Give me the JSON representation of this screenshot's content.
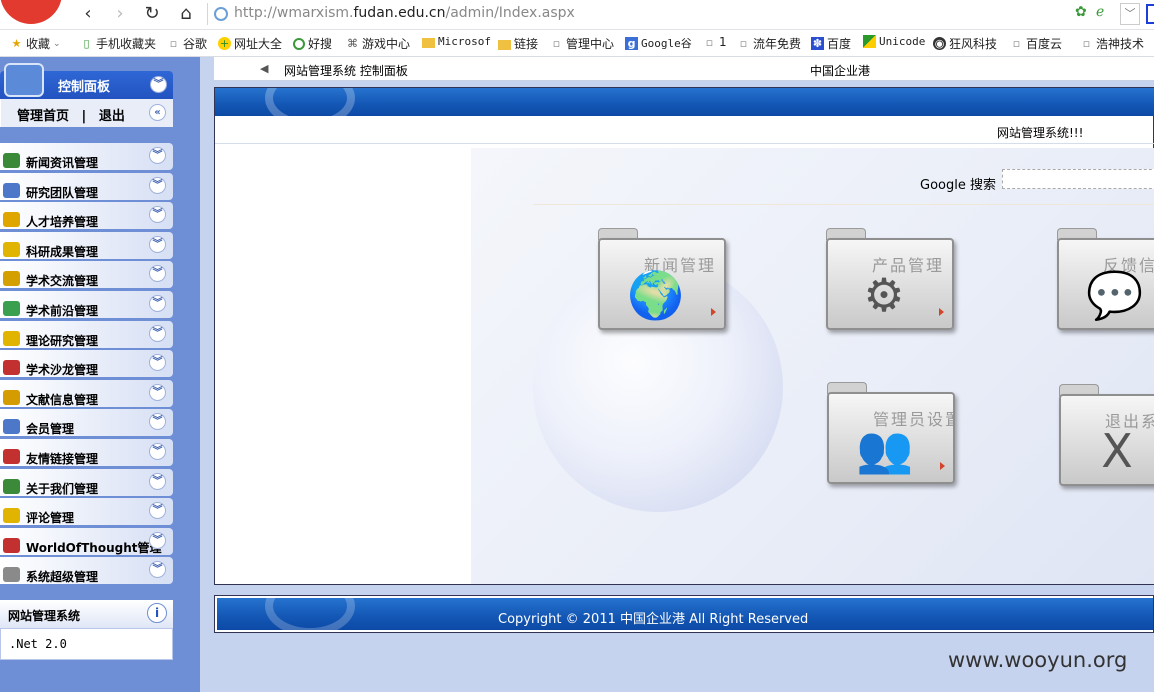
{
  "browser": {
    "url_prefix": "http://wmarxism.",
    "url_host": "fudan.edu.cn",
    "url_path": "/admin/Index.aspx",
    "nav": {
      "back": "‹",
      "forward": "›",
      "reload": "↻",
      "home": "⌂"
    },
    "bookmarks": [
      {
        "label": "收藏",
        "icon": "star-icon"
      },
      {
        "label": "手机收藏夹",
        "icon": "phone-icon"
      },
      {
        "label": "谷歌",
        "icon": "page-icon"
      },
      {
        "label": "网址大全",
        "icon": "hao123-icon"
      },
      {
        "label": "好搜",
        "icon": "search-icon"
      },
      {
        "label": "游戏中心",
        "icon": "gamepad-icon"
      },
      {
        "label": "Microsof",
        "icon": "folder-icon"
      },
      {
        "label": "链接",
        "icon": "folder-icon"
      },
      {
        "label": "管理中心",
        "icon": "page-icon"
      },
      {
        "label": "Google谷",
        "icon": "google-icon"
      },
      {
        "label": "1",
        "icon": "page-icon"
      },
      {
        "label": "流年免费",
        "icon": "page-icon"
      },
      {
        "label": "百度",
        "icon": "baidu-icon"
      },
      {
        "label": "Unicode",
        "icon": "unicode-icon"
      },
      {
        "label": "狂风科技",
        "icon": "globe-icon"
      },
      {
        "label": "百度云",
        "icon": "page-icon"
      },
      {
        "label": "浩神技术",
        "icon": "page-icon"
      }
    ]
  },
  "sidebar": {
    "header_title": "控制面板",
    "home_link": "管理首页",
    "separator": "|",
    "logout_link": "退出",
    "items": [
      {
        "label": "新闻资讯管理",
        "color": "#3a8a3a"
      },
      {
        "label": "研究团队管理",
        "color": "#4d78c9"
      },
      {
        "label": "人才培养管理",
        "color": "#e0a600"
      },
      {
        "label": "科研成果管理",
        "color": "#e0b400"
      },
      {
        "label": "学术交流管理",
        "color": "#d4a000"
      },
      {
        "label": "学术前沿管理",
        "color": "#3aa050"
      },
      {
        "label": "理论研究管理",
        "color": "#e0b400"
      },
      {
        "label": "学术沙龙管理",
        "color": "#c23030"
      },
      {
        "label": "文献信息管理",
        "color": "#d49c00"
      },
      {
        "label": "会员管理",
        "color": "#4d78c9"
      },
      {
        "label": "友情链接管理",
        "color": "#c23030"
      },
      {
        "label": "关于我们管理",
        "color": "#3a8a3a"
      },
      {
        "label": "评论管理",
        "color": "#e0b400"
      },
      {
        "label": "WorldOfThought管理",
        "color": "#c23030"
      },
      {
        "label": "系统超级管理",
        "color": "#8a8a8a"
      }
    ],
    "info_title": "网站管理系统",
    "version": ".Net 2.0"
  },
  "main": {
    "breadcrumb": "网站管理系统 控制面板",
    "company": "中国企业港",
    "welcome": "网站管理系统!!!",
    "google_label": "Google 搜索",
    "tiles": [
      {
        "label": "新闻管理",
        "glyph": "🌍"
      },
      {
        "label": "产品管理",
        "glyph": "⚙"
      },
      {
        "label": "反馈信息",
        "glyph": "💬"
      },
      {
        "label": "管理员设置",
        "glyph": "👥"
      },
      {
        "label": "退出系统",
        "glyph": "X"
      }
    ],
    "copyright": "Copyright © 2011 中国企业港  All Right Reserved"
  },
  "watermark": "www.wooyun.org"
}
